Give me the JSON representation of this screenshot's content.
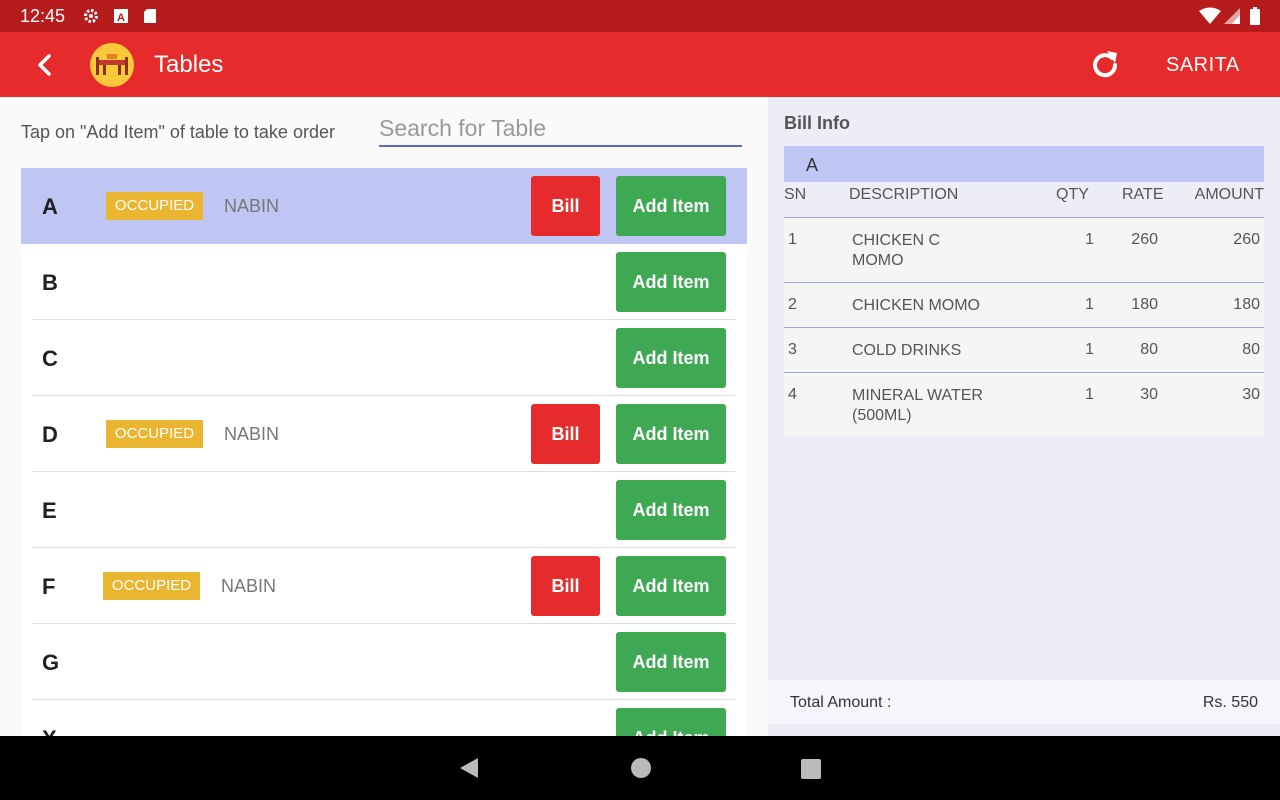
{
  "status_bar": {
    "time": "12:45",
    "icons": [
      "gear-icon",
      "a-icon",
      "sdcard-icon",
      "wifi-icon",
      "signal-icon",
      "battery-icon"
    ]
  },
  "app_bar": {
    "title": "Tables",
    "user": "SARITA",
    "color": "#e52b2b"
  },
  "left": {
    "hint": "Tap on \"Add Item\" of table to take order",
    "search_placeholder": "Search for Table",
    "tables": [
      {
        "name": "A",
        "status": "OCCUPIED",
        "waiter": "NABIN",
        "bill": "Bill",
        "add": "Add Item",
        "selected": true
      },
      {
        "name": "B",
        "add": "Add Item"
      },
      {
        "name": "C",
        "add": "Add Item"
      },
      {
        "name": "D",
        "status": "OCCUPIED",
        "waiter": "NABIN",
        "bill": "Bill",
        "add": "Add Item"
      },
      {
        "name": "E",
        "add": "Add Item"
      },
      {
        "name": "F",
        "status": "OCCUPIED",
        "waiter": "NABIN",
        "bill": "Bill",
        "add": "Add Item"
      },
      {
        "name": "G",
        "add": "Add Item"
      },
      {
        "name": "X",
        "add": "Add Item"
      }
    ]
  },
  "bill": {
    "title": "Bill Info",
    "table": "A",
    "columns": {
      "sn": "SN",
      "description": "DESCRIPTION",
      "qty": "QTY",
      "rate": "RATE",
      "amount": "AMOUNT"
    },
    "items": [
      {
        "sn": "1",
        "line1": "CHICKEN C",
        "line2": "MOMO",
        "qty": "1",
        "rate": "260",
        "amount": "260"
      },
      {
        "sn": "2",
        "line1": "CHICKEN MOMO",
        "line2": "",
        "qty": "1",
        "rate": "180",
        "amount": "180"
      },
      {
        "sn": "3",
        "line1": "COLD DRINKS",
        "line2": "",
        "qty": "1",
        "rate": "80",
        "amount": "80"
      },
      {
        "sn": "4",
        "line1": "MINERAL WATER",
        "line2": "(500ML)",
        "qty": "1",
        "rate": "30",
        "amount": "30"
      }
    ],
    "total_label": "Total Amount :",
    "total_value": "Rs. 550"
  }
}
